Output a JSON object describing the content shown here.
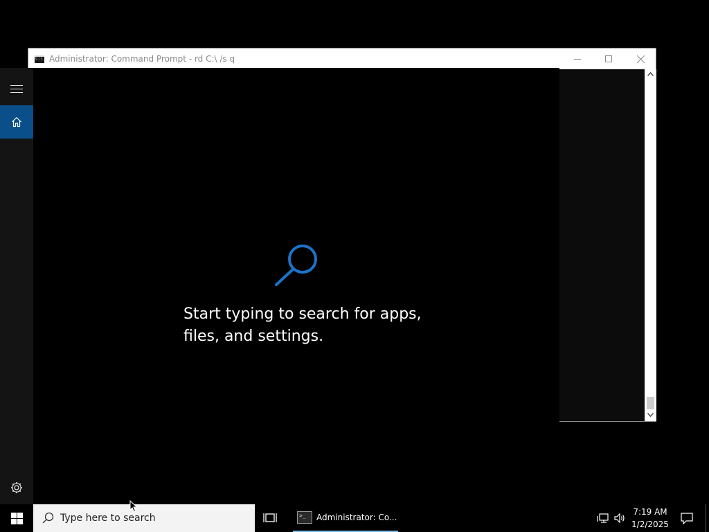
{
  "cmd_window": {
    "title": "Administrator: Command Prompt - rd  C:\\ /s q",
    "icon": "cmd-icon",
    "buttons": {
      "minimize": "minimize-icon",
      "maximize": "maximize-icon",
      "close": "close-icon"
    }
  },
  "start_menu": {
    "rail": {
      "menu_icon": "hamburger-icon",
      "home_icon": "home-icon",
      "settings_icon": "gear-icon"
    },
    "search_prompt": "Start typing to search for apps, files, and settings.",
    "accent_color": "#1a73c9"
  },
  "taskbar": {
    "start_icon": "windows-logo-icon",
    "search_placeholder": "Type here to search",
    "task_view_icon": "task-view-icon",
    "running_app_label": "Administrator: Co...",
    "tray": {
      "network_icon": "network-icon",
      "volume_icon": "volume-icon"
    },
    "time": "7:19 AM",
    "date": "1/2/2025",
    "action_center_icon": "action-center-icon"
  }
}
